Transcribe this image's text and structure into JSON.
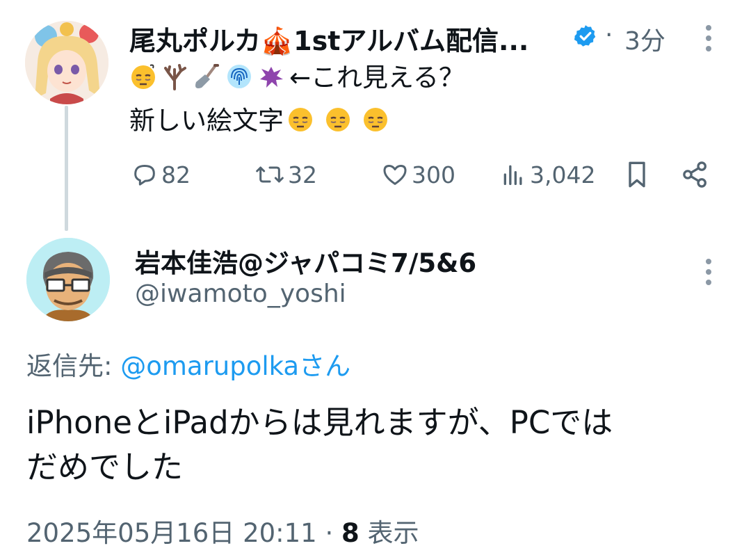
{
  "parent_tweet": {
    "display_name": "尾丸ポルカ🎪1stアルバム配信...",
    "verified_icon": "verified-badge-icon",
    "separator": "·",
    "time": "3分",
    "line1_text": "←これ見える？",
    "line1_emojis": [
      "face-with-bags-under-eyes",
      "leafless-tree",
      "shovel",
      "fingerprint",
      "splatter"
    ],
    "line2_text": "新しい絵文字",
    "line2_emojis": [
      "face-with-bags-under-eyes",
      "face-with-bags-under-eyes",
      "face-with-bags-under-eyes"
    ],
    "actions": {
      "replies": "82",
      "retweets": "32",
      "likes": "300",
      "views": "3,042"
    }
  },
  "reply_tweet": {
    "display_name": "岩本佳浩@ジャパコミ7/5&6",
    "handle": "@iwamoto_yoshi",
    "reply_to_label": "返信先: ",
    "reply_to_user": "@omarupolka",
    "reply_to_suffix": "さん",
    "body_line1": "iPhoneとiPadからは見れますが、PCでは",
    "body_line2": "だめでした",
    "timestamp": "2025年05月16日 20:11",
    "separator": "·",
    "view_count": "8",
    "view_label": "表示"
  },
  "colors": {
    "accent": "#1d9bf0",
    "muted": "#536471",
    "text": "#0f1419",
    "thread_line": "#cfd9de"
  }
}
